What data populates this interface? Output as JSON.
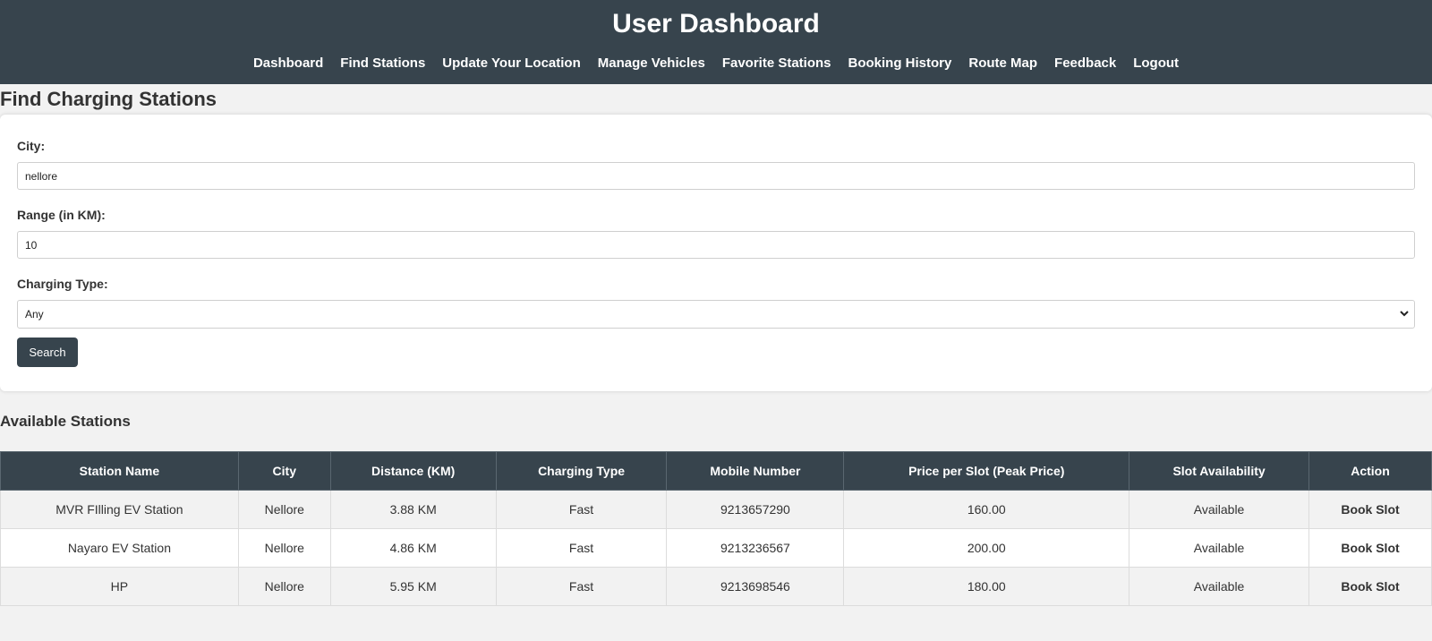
{
  "header": {
    "title": "User Dashboard",
    "nav": [
      "Dashboard",
      "Find Stations",
      "Update Your Location",
      "Manage Vehicles",
      "Favorite Stations",
      "Booking History",
      "Route Map",
      "Feedback",
      "Logout"
    ]
  },
  "page_title": "Find Charging Stations",
  "form": {
    "city_label": "City:",
    "city_value": "nellore",
    "range_label": "Range (in KM):",
    "range_value": "10",
    "type_label": "Charging Type:",
    "type_value": "Any",
    "search_label": "Search"
  },
  "results": {
    "title": "Available Stations",
    "columns": [
      "Station Name",
      "City",
      "Distance (KM)",
      "Charging Type",
      "Mobile Number",
      "Price per Slot (Peak Price)",
      "Slot Availability",
      "Action"
    ],
    "rows": [
      [
        "MVR FIlling EV Station",
        "Nellore",
        "3.88 KM",
        "Fast",
        "9213657290",
        "160.00",
        "Available",
        "Book Slot"
      ],
      [
        "Nayaro EV Station",
        "Nellore",
        "4.86 KM",
        "Fast",
        "9213236567",
        "200.00",
        "Available",
        "Book Slot"
      ],
      [
        "HP",
        "Nellore",
        "5.95 KM",
        "Fast",
        "9213698546",
        "180.00",
        "Available",
        "Book Slot"
      ]
    ]
  },
  "colors": {
    "header_bg": "#37444d",
    "page_bg": "#f2f2f2"
  }
}
